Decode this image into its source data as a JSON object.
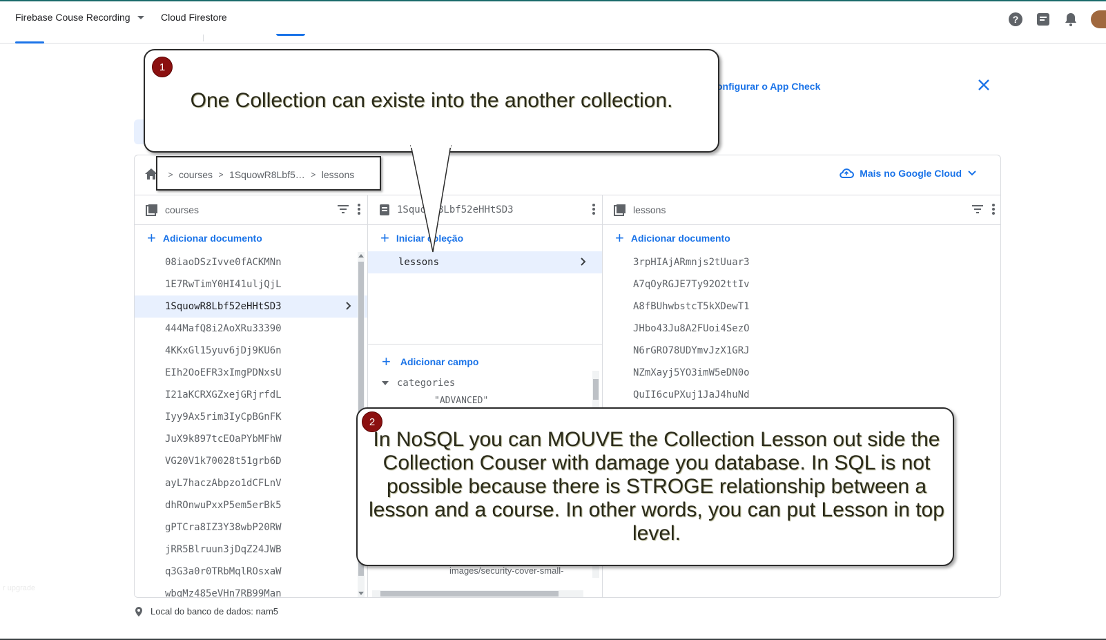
{
  "topbar": {
    "project": "Firebase Couse Recording",
    "product": "Cloud Firestore",
    "icons": [
      "help-icon",
      "feedback-icon",
      "notifications-icon",
      "avatar"
    ]
  },
  "banner": {
    "link": "onfigurar o App Check"
  },
  "breadcrumb": {
    "items": [
      "courses",
      "1SquowR8Lbf5…",
      "lessons"
    ]
  },
  "cloud_link": "Mais no Google Cloud",
  "columns": {
    "col1": {
      "title": "courses",
      "add_label": "Adicionar documento",
      "docs": [
        "08iaoDSzIvve0fACKMNn",
        "1E7RwTimY0HI41uljQjL",
        "1SquowR8Lbf52eHHtSD3",
        "444MafQ8i2AoXRu33390",
        "4KKxGl15yuv6jDj9KU6n",
        "EIh2OoEFR3xImgPDNxsU",
        "I21aKCRXGZxejGRjrfdL",
        "Iyy9Ax5rim3IyCpBGnFK",
        "JuX9k897tcEOaPYbMFhW",
        "VG20V1k70028t51grb6D",
        "ayL7haczAbpzo1dCFLnV",
        "dhROnwuPxxP5em5erBk5",
        "gPTCra8IZ3Y38wbP20RW",
        "jRR5Blruun3jDqZ24JWB",
        "q3G3a0r0TRbMqlROsxaW",
        "wbgMz485eVHn7RB99Man"
      ],
      "selected_index": 2
    },
    "col2": {
      "title": "1SquowR8Lbf52eHHtSD3",
      "add_collection": "Iniciar coleção",
      "subcollection": "lessons",
      "add_field": "Adicionar campo",
      "field_name": "categories",
      "field_value_partial": "\"ADVANCED\"",
      "url_text": "university/course-images/security-cover-small-"
    },
    "col3": {
      "title": "lessons",
      "add_label": "Adicionar documento",
      "docs": [
        "3rpHIAjARmnjs2tUuar3",
        "A7qOyRGJE7Ty92O2ttIv",
        "A8fBUhwbstcT5kXDewT1",
        "JHbo43Ju8A2FUoi4SezO",
        "N6rGRO78UDYmvJzX1GRJ",
        "NZmXayj5YO3imW5eDN0o",
        "QuII6cuPXuj1JaJ4huNd"
      ]
    }
  },
  "footer": {
    "location": "Local do banco de dados: nam5",
    "upgrade": "r upgrade"
  },
  "callouts": {
    "one": {
      "badge": "1",
      "text": "One Collection can existe into the another collection."
    },
    "two": {
      "badge": "2",
      "text": "In NoSQL you can MOUVE the Collection Lesson out side the Collection Couser with damage you database. In SQL is not possible because there is STROGE relationship between a lesson and a course.  In other words, you can put Lesson in top level."
    }
  },
  "colors": {
    "accent": "#1a73e8",
    "selected_row": "#e8f0fe",
    "badge": "#8b1010"
  }
}
